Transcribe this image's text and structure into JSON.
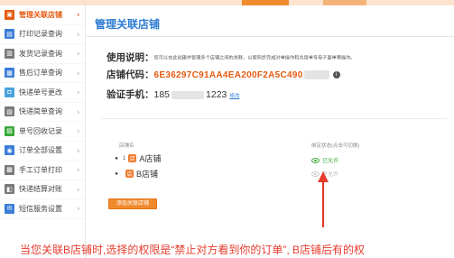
{
  "sidebar": {
    "items": [
      {
        "label": "管理关联店铺",
        "icon": "shop-icon",
        "color": "#e35b12",
        "active": true
      },
      {
        "label": "打印记录查询",
        "icon": "print-log-icon",
        "color": "#3b7dd8"
      },
      {
        "label": "发货记录查询",
        "icon": "ship-log-icon",
        "color": "#7a7a7a"
      },
      {
        "label": "售后订单查询",
        "icon": "aftersale-icon",
        "color": "#3b7dd8"
      },
      {
        "label": "快递单号更改",
        "icon": "tracking-edit-icon",
        "color": "#4aa3df"
      },
      {
        "label": "快递简单查询",
        "icon": "express-search-icon",
        "color": "#7a7a7a"
      },
      {
        "label": "单号回收记录",
        "icon": "recycle-icon",
        "color": "#3aa83a"
      },
      {
        "label": "订单全部设置",
        "icon": "settings-icon",
        "color": "#3b7dd8"
      },
      {
        "label": "手工订单打印",
        "icon": "manual-print-icon",
        "color": "#7a7a7a"
      },
      {
        "label": "快递结算对账",
        "icon": "reconcile-icon",
        "color": "#7a7a7a"
      },
      {
        "label": "短信服务设置",
        "icon": "sms-icon",
        "color": "#3b7dd8"
      }
    ]
  },
  "main": {
    "title": "管理关联店铺",
    "usage_label": "使用说明：",
    "usage_text": "您可以在此创建并管理多个店铺之间的关联，以便同步完成对单操作和共用单号电子面单等操作。",
    "code_label": "店铺代码：",
    "code_value": "6E36297C91AA4EA200F2A5C490",
    "phone_label": "验证手机：",
    "phone_prefix": "185",
    "phone_suffix": "1223",
    "phone_edit": "修改",
    "col_shop": "店铺名",
    "col_status": "绑定状态(点击可切换)",
    "shops": [
      {
        "bullet": "●",
        "num": "1",
        "name": "A店铺",
        "status": "已允许"
      },
      {
        "bullet": "●",
        "num": "",
        "name": "B店铺",
        "status": "不允许"
      }
    ],
    "add_button": "添加关联店铺",
    "note": "当您关联B店铺时,选择的权限是“禁止对方看到你的订单”, B店铺后有的权"
  },
  "colors": {
    "accent": "#e35b12",
    "title_blue": "#2c7bd1",
    "enabled_green": "#3aa83a",
    "note_red": "#e63b2e"
  }
}
